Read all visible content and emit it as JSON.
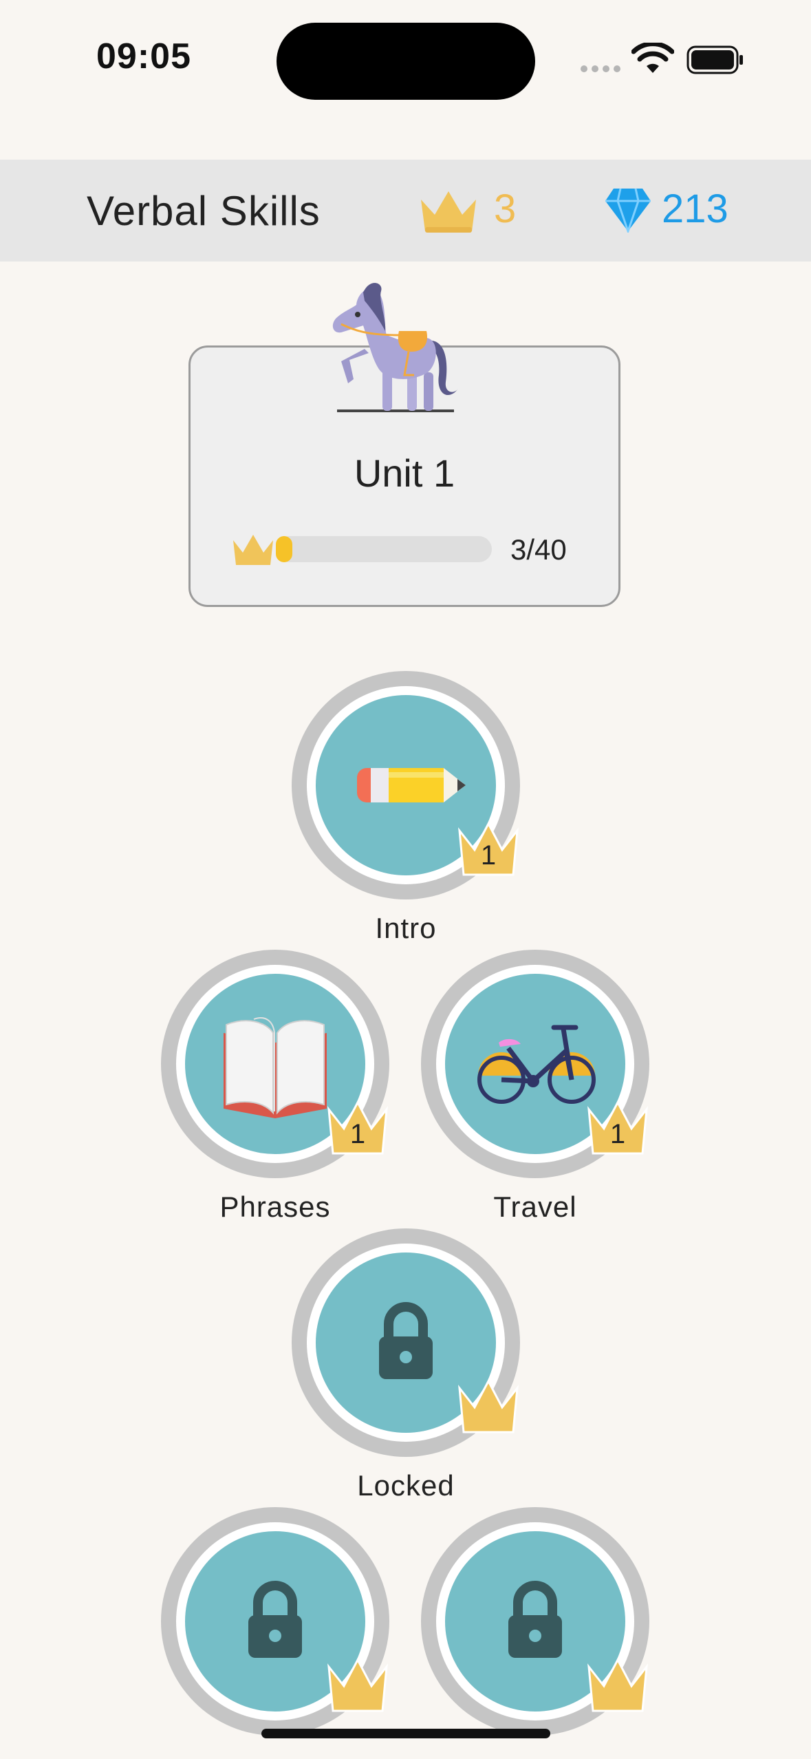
{
  "status": {
    "time": "09:05"
  },
  "header": {
    "title": "Verbal Skills",
    "crowns": "3",
    "gems": "213"
  },
  "unit": {
    "title": "Unit 1",
    "progress_text": "3/40",
    "progress_fraction": 0.075
  },
  "skills": [
    {
      "label": "Intro",
      "icon": "pencil-icon",
      "crown_level": "1"
    },
    {
      "label": "Phrases",
      "icon": "book-icon",
      "crown_level": "1"
    },
    {
      "label": "Travel",
      "icon": "bicycle-icon",
      "crown_level": "1"
    },
    {
      "label": "Locked",
      "icon": "lock-icon",
      "crown_level": ""
    },
    {
      "label": "",
      "icon": "lock-icon",
      "crown_level": ""
    },
    {
      "label": "",
      "icon": "lock-icon",
      "crown_level": ""
    }
  ],
  "colors": {
    "background": "#f9f6f2",
    "header": "#e6e6e6",
    "crown": "#f0bc52",
    "gem": "#1e9be6",
    "skill_disc": "#75bec7",
    "progress": "#f6c228"
  }
}
